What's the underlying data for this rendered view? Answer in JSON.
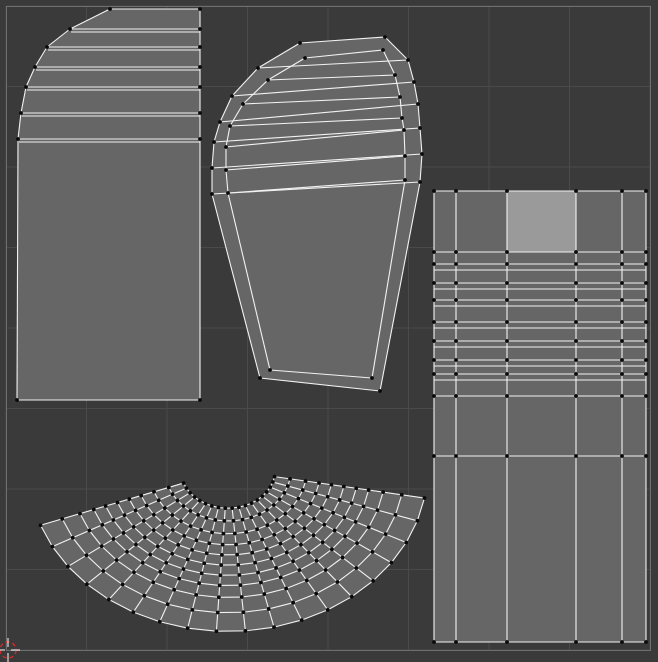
{
  "editor": {
    "type": "uv-editor",
    "background_color": "#3a3a3a",
    "grid_line_color": "#4a4a4a",
    "grid_major_color": "#555555",
    "bounds_color": "#6e6e6e",
    "face_color": "#666666",
    "selected_face_color": "#9a9a9a",
    "edge_color": "#f2f2f2",
    "vertex_color": "#0a0a0a",
    "cursor_color": "#cc2b2b"
  },
  "islands": [
    {
      "name": "uv-island-sleeve-left",
      "shape": "tapered-rect-with-rounded-top"
    },
    {
      "name": "uv-island-sleeve-right",
      "shape": "trapezoid-with-rounded-top"
    },
    {
      "name": "uv-island-collar-arc",
      "shape": "fan-arc"
    },
    {
      "name": "uv-island-body-grid",
      "shape": "grid",
      "selected_faces": 1
    }
  ],
  "cursor": {
    "icon": "2d-cursor-icon"
  }
}
